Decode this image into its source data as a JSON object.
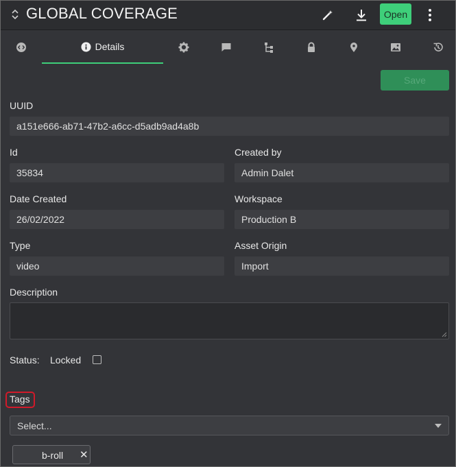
{
  "header": {
    "title": "GLOBAL COVERAGE",
    "open_label": "Open",
    "icons": [
      "sort-icon",
      "magic-wand-icon",
      "download-icon",
      "more-vertical-icon"
    ]
  },
  "tabs": [
    {
      "name": "code-icon",
      "label": ""
    },
    {
      "name": "info-icon",
      "label": "Details",
      "active": true
    },
    {
      "name": "gear-icon",
      "label": ""
    },
    {
      "name": "comment-icon",
      "label": ""
    },
    {
      "name": "hierarchy-icon",
      "label": ""
    },
    {
      "name": "lock-icon",
      "label": ""
    },
    {
      "name": "location-pin-icon",
      "label": ""
    },
    {
      "name": "image-icon",
      "label": ""
    },
    {
      "name": "history-icon",
      "label": ""
    }
  ],
  "form": {
    "save_label": "Save",
    "uuid": {
      "label": "UUID",
      "value": "a151e666-ab71-47b2-a6cc-d5adb9ad4a8b"
    },
    "id": {
      "label": "Id",
      "value": "35834"
    },
    "created_by": {
      "label": "Created by",
      "value": "Admin Dalet"
    },
    "date_created": {
      "label": "Date Created",
      "value": "26/02/2022"
    },
    "workspace": {
      "label": "Workspace",
      "value": "Production B"
    },
    "type": {
      "label": "Type",
      "value": "video"
    },
    "asset_origin": {
      "label": "Asset Origin",
      "value": "Import"
    },
    "description": {
      "label": "Description",
      "value": ""
    },
    "status": {
      "label": "Status:",
      "locked_label": "Locked",
      "locked": false
    },
    "tags": {
      "label": "Tags",
      "placeholder": "Select...",
      "chips": [
        "b-roll"
      ]
    }
  },
  "colors": {
    "accent": "#3ecf7a",
    "background": "#333438",
    "header": "#2c2d30",
    "field": "#3d3e42",
    "highlight": "#d21a2a"
  }
}
